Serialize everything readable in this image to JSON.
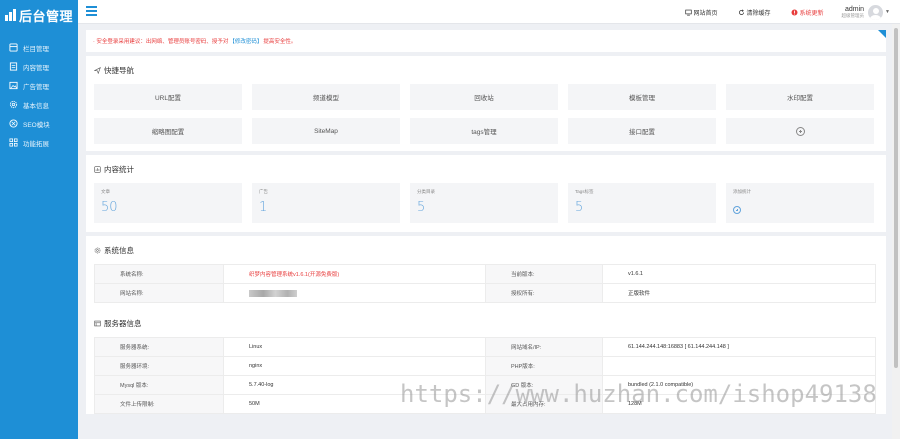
{
  "app": {
    "logo_text": "后台管理"
  },
  "sidebar": {
    "items": [
      {
        "label": "栏目管理",
        "icon": "grid-icon"
      },
      {
        "label": "内容管理",
        "icon": "document-icon"
      },
      {
        "label": "广告管理",
        "icon": "image-icon"
      },
      {
        "label": "基本信息",
        "icon": "gear-icon"
      },
      {
        "label": "SEO模块",
        "icon": "globe-icon"
      },
      {
        "label": "功能拓展",
        "icon": "apps-icon"
      }
    ]
  },
  "header": {
    "links": [
      {
        "label": "网站首页",
        "icon": "monitor-icon"
      },
      {
        "label": "清除缓存",
        "icon": "refresh-icon"
      },
      {
        "label": "系统更新",
        "icon": "alert-icon"
      }
    ],
    "user": {
      "name": "admin",
      "role": "超级管理员"
    },
    "colors": {
      "accent": "#1e8fd6",
      "danger": "#e83c3c"
    }
  },
  "notice": {
    "prefix": "· 安全登录采用建议：出网络、管理员账号密码、授予对",
    "link": "【修改密码】",
    "suffix": "提高安全性。"
  },
  "quick_nav": {
    "title": "快捷导航",
    "items": [
      "URL配置",
      "频道模型",
      "回收站",
      "模板管理",
      "水印配置",
      "缩略图配置",
      "SiteMap",
      "tags管理",
      "接口配置"
    ]
  },
  "content_stats": {
    "title": "内容统计",
    "items": [
      {
        "label": "文章",
        "value": "50"
      },
      {
        "label": "广告",
        "value": "1"
      },
      {
        "label": "分类目录",
        "value": "5"
      },
      {
        "label": "Tags标签",
        "value": "5"
      },
      {
        "label": "添加统计",
        "value": ""
      }
    ]
  },
  "system_info": {
    "title": "系统信息",
    "rows": [
      {
        "k1": "系统名称:",
        "v1": "织梦内容管理系统v1.6.1(开源免费版)",
        "k2": "当前版本:",
        "v2": "v1.6.1"
      },
      {
        "k1": "网站名称:",
        "v1": "",
        "k2": "授权所有:",
        "v2": "正版软件"
      }
    ]
  },
  "server_info": {
    "title": "服务器信息",
    "rows": [
      {
        "k1": "服务器系统:",
        "v1": "Linux",
        "k2": "网站域名/IP:",
        "v2": "61.144.244.148:16883 [ 61.144.244.148 ]"
      },
      {
        "k1": "服务器环境:",
        "v1": "nginx",
        "k2": "PHP版本:",
        "v2": ""
      },
      {
        "k1": "Mysql 版本:",
        "v1": "5.7.40-log",
        "k2": "GD 版本:",
        "v2": "bundled (2.1.0 compatible)"
      },
      {
        "k1": "文件上传限制:",
        "v1": "50M",
        "k2": "最大占用内存:",
        "v2": "128M"
      }
    ]
  },
  "watermark": "https://www.huzhan.com/ishop49138"
}
